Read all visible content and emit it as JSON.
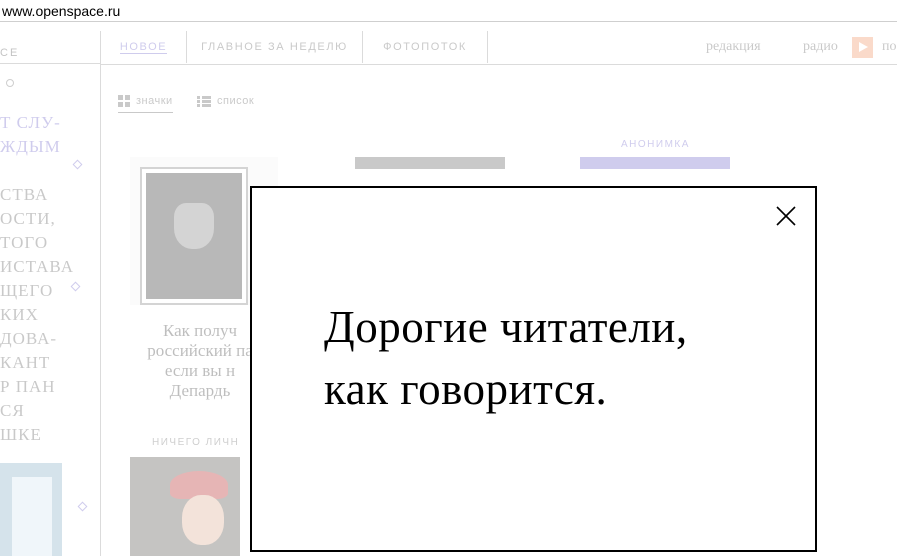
{
  "browser": {
    "url": "www.openspace.ru"
  },
  "sidebar": {
    "logo_fragment": "CE",
    "headline_1": "Т СЛУ-\nЖДЫМ",
    "headline_2": "СТВА\nОСТИ,\nТОГО\nИСТАВА\nЩЕГО\nКИХ\nДОВА-\nКАНТ\nР ПАН\nСЯ\nШКЕ"
  },
  "nav": {
    "tabs": [
      "НОВОЕ",
      "ГЛАВНОЕ ЗА НЕДЕЛЮ",
      "ФОТОПОТОК"
    ],
    "links": {
      "editor": "редакция",
      "radio": "радио",
      "po": "по"
    }
  },
  "view_toggle": {
    "icons": "значки",
    "list": "список"
  },
  "content": {
    "card_caption": "Как получ\nроссийский па\nесли вы н\nДепардь",
    "section_label_1": "НИЧЕГО ЛИЧН",
    "section_label_2": "АНОНИМКА"
  },
  "modal": {
    "line_1": "Дорогие читатели,",
    "line_2": "как говорится."
  },
  "colors": {
    "accent": "#6a5ec7",
    "radio_play": "#f08c5a"
  }
}
